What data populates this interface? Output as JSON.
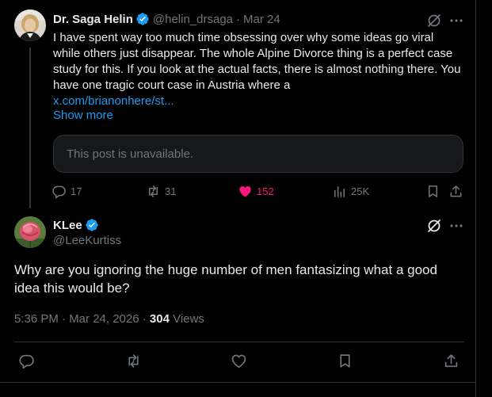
{
  "post1": {
    "author_name": "Dr. Saga Helin",
    "handle": "@helin_drsaga",
    "separator": "·",
    "date": "Mar 24",
    "text": "I have spent way too much time obsessing over why some ideas go viral while others just disappear. The whole Alpine Divorce thing is a perfect case study for this. If you look at the actual facts, there is almost nothing there. You have one tragic court case in Austria where a",
    "link_text": "x.com/brianonhere/st...",
    "show_more": "Show more",
    "quote_unavailable": "This post is unavailable.",
    "replies": "17",
    "reposts": "31",
    "likes": "152",
    "views": "25K",
    "like_color": "#f91880"
  },
  "post2": {
    "author_name": "KLee",
    "handle": "@LeeKurtiss",
    "text": "Why are you ignoring the huge number of men fantasizing what a good idea this would be?",
    "timestamp": "5:36 PM · Mar 24, 2026 · ",
    "views_count": "304",
    "views_label": " Views"
  },
  "colors": {
    "background": "#000000",
    "text": "#e7e9ea",
    "muted": "#71767b",
    "link": "#1d9bf0",
    "verified": "#1d9bf0",
    "border": "#2f3336"
  },
  "icons": {
    "verified": "verified-badge-icon",
    "grok": "grok-icon",
    "more": "more-icon",
    "reply": "reply-icon",
    "repost": "repost-icon",
    "like": "like-icon",
    "views": "views-icon",
    "bookmark": "bookmark-icon",
    "share": "share-icon"
  }
}
